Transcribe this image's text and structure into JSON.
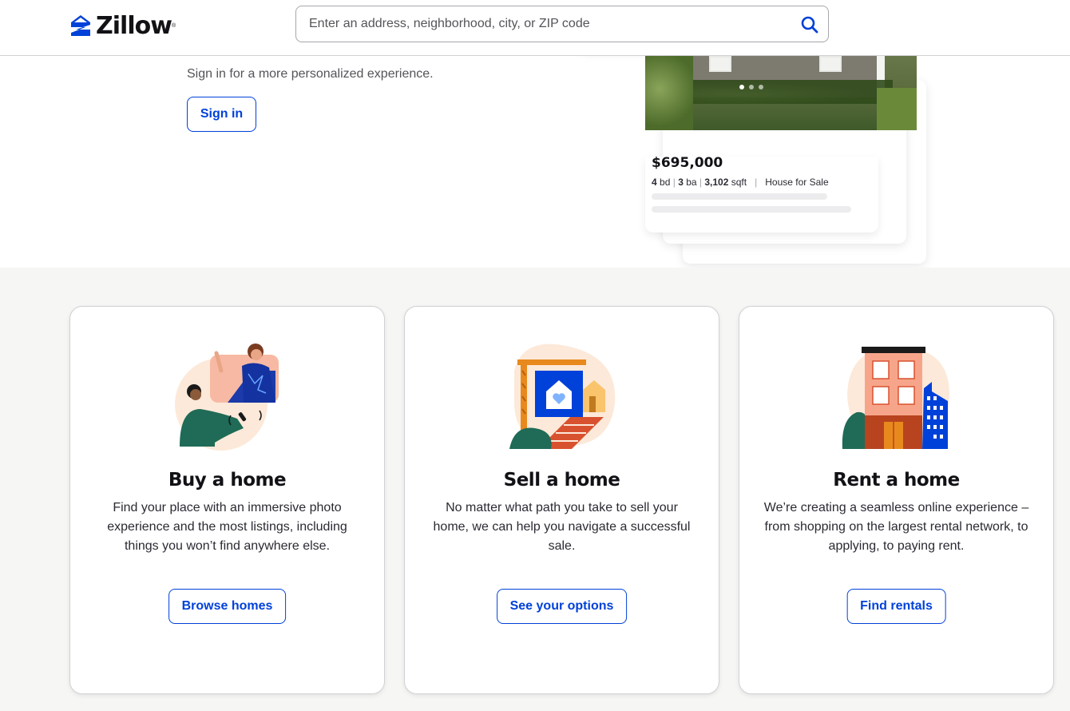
{
  "header": {
    "logo_text": "Zillow",
    "search": {
      "placeholder": "Enter an address, neighborhood, city, or ZIP code",
      "icon": "search-icon"
    }
  },
  "hero": {
    "subtitle": "Sign in for a more personalized experience.",
    "signin_label": "Sign in",
    "listing": {
      "price": "$695,000",
      "beds": "4",
      "beds_unit": "bd",
      "baths": "3",
      "baths_unit": "ba",
      "sqft": "3,102",
      "sqft_unit": "sqft",
      "type": "House for Sale"
    }
  },
  "cards": [
    {
      "title": "Buy a home",
      "description": "Find your place with an immersive photo experience and the most listings, including things you won’t find anywhere else.",
      "cta": "Browse homes"
    },
    {
      "title": "Sell a home",
      "description": "No matter what path you take to sell your home, we can help you navigate a successful sale.",
      "cta": "See your options"
    },
    {
      "title": "Rent a home",
      "description": "We’re creating a seamless online experience – from shopping on the largest rental network, to applying, to paying rent.",
      "cta": "Find rentals"
    }
  ],
  "colors": {
    "brand_blue": "#0041d9",
    "text_dark": "#111116",
    "bg_section": "#f6f6f4"
  }
}
